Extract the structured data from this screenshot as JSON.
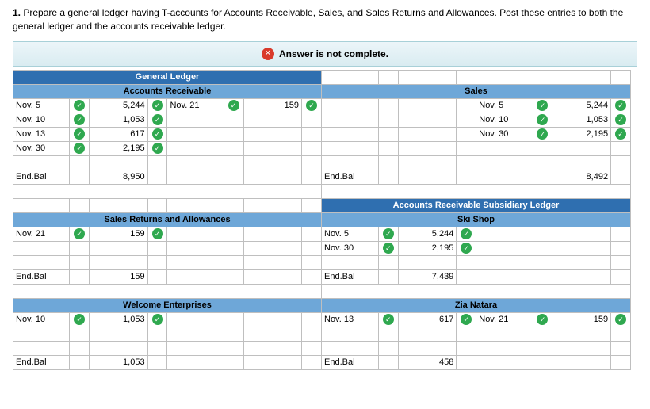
{
  "question": {
    "num": "1.",
    "text": "Prepare a general ledger having T-accounts for Accounts Receivable, Sales, and Sales Returns and Allowances. Post these entries to both the general ledger and the accounts receivable ledger."
  },
  "alert": {
    "icon": "✕",
    "text": "Answer is not complete."
  },
  "headers": {
    "general_ledger": "General Ledger",
    "accounts_receivable": "Accounts Receivable",
    "sales": "Sales",
    "sales_returns": "Sales Returns and Allowances",
    "subsidiary": "Accounts Receivable Subsidiary Ledger",
    "ski_shop": "Ski Shop",
    "welcome": "Welcome Enterprises",
    "zia": "Zia Natara",
    "endbal": "End.Bal"
  },
  "ok": "✓",
  "ar": {
    "r1": {
      "d": "Nov. 5",
      "a": "5,244",
      "d2": "Nov. 21",
      "a2": "159"
    },
    "r2": {
      "d": "Nov. 10",
      "a": "1,053"
    },
    "r3": {
      "d": "Nov. 13",
      "a": "617"
    },
    "r4": {
      "d": "Nov. 30",
      "a": "2,195"
    },
    "bal": "8,950"
  },
  "sales": {
    "r1": {
      "d": "Nov. 5",
      "a": "5,244"
    },
    "r2": {
      "d": "Nov. 10",
      "a": "1,053"
    },
    "r3": {
      "d": "Nov. 30",
      "a": "2,195"
    },
    "bal": "8,492"
  },
  "sra": {
    "r1": {
      "d": "Nov. 21",
      "a": "159"
    },
    "bal": "159"
  },
  "ski": {
    "r1": {
      "d": "Nov. 5",
      "a": "5,244"
    },
    "r2": {
      "d": "Nov. 30",
      "a": "2,195"
    },
    "bal": "7,439"
  },
  "welcome": {
    "r1": {
      "d": "Nov. 10",
      "a": "1,053"
    },
    "bal": "1,053"
  },
  "zia": {
    "r1": {
      "d": "Nov. 13",
      "a": "617",
      "d2": "Nov. 21",
      "a2": "159"
    },
    "bal": "458"
  }
}
